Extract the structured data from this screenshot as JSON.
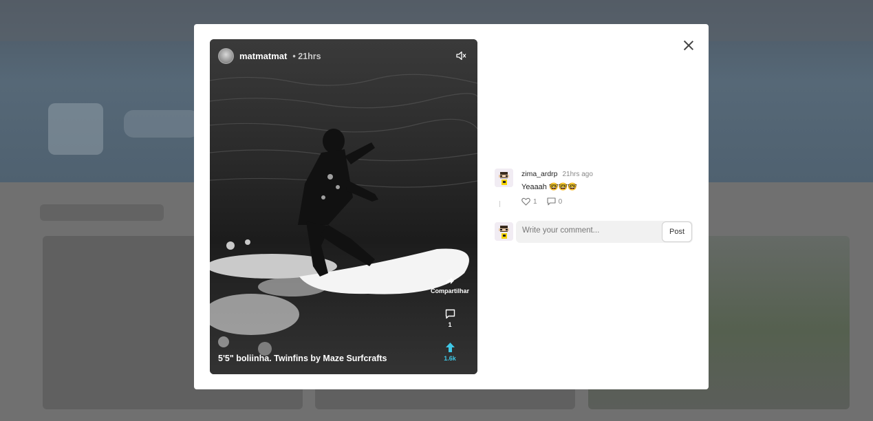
{
  "post": {
    "username": "matmatmat",
    "time": "• 21hrs",
    "caption": "5'5\" boliinha. Twinfins by Maze Surfcrafts",
    "actions": {
      "share_label": "Compartilhar",
      "comments_count": "1",
      "votes_count": "1.6k"
    }
  },
  "comments": [
    {
      "username": "zima_ardrp",
      "time": "21hrs ago",
      "text": "Yeaaah 🤓🤓🤓",
      "likes": "1",
      "replies": "0"
    }
  ],
  "composer": {
    "placeholder": "Write your comment...",
    "post_label": "Post"
  },
  "colors": {
    "vote_accent": "#3fc7e6",
    "modal_bg": "#ffffff",
    "overlay": "#6d6d6d"
  },
  "icons": [
    "mute-icon",
    "share-arrow-icon",
    "comment-bubble-icon",
    "upvote-arrow-icon",
    "heart-icon",
    "close-icon"
  ]
}
